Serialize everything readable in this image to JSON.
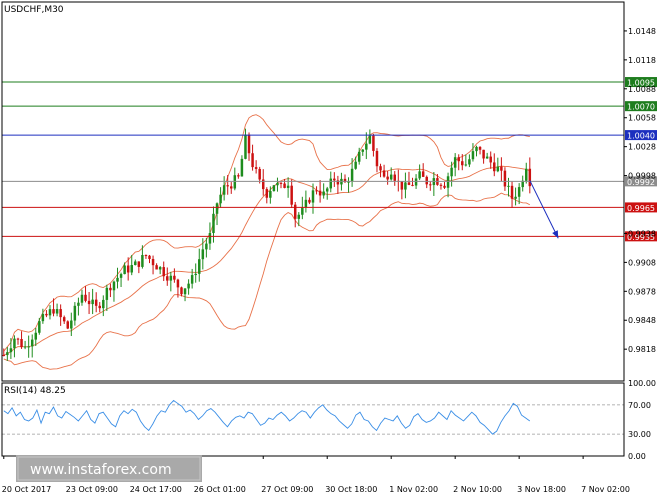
{
  "chart_data": [
    {
      "type": "candlestick",
      "title": "USDCHF,M30",
      "x_labels": [
        "20 Oct 2017",
        "23 Oct 09:00",
        "24 Oct 17:00",
        "26 Oct 01:00",
        "27 Oct 09:00",
        "30 Oct 18:00",
        "1 Nov 02:00",
        "2 Nov 10:00",
        "3 Nov 18:00",
        "7 Nov 02:00"
      ],
      "y_tick_labels": [
        "1.0148",
        "1.0118",
        "1.0088",
        "1.0058",
        "1.0028",
        "0.9998",
        "0.9938",
        "0.9908",
        "0.9878",
        "0.9848",
        "0.9818"
      ],
      "ylim": [
        0.9785,
        1.0178
      ],
      "price_path": [
        [
          0,
          0.9812
        ],
        [
          3,
          0.983
        ],
        [
          6,
          0.982
        ],
        [
          10,
          0.9845
        ],
        [
          14,
          0.986
        ],
        [
          18,
          0.984
        ],
        [
          22,
          0.9875
        ],
        [
          26,
          0.986
        ],
        [
          30,
          0.9885
        ],
        [
          34,
          0.99
        ],
        [
          37,
          0.9905
        ],
        [
          40,
          0.9915
        ],
        [
          43,
          0.9905
        ],
        [
          46,
          0.9895
        ],
        [
          50,
          0.988
        ],
        [
          53,
          0.989
        ],
        [
          56,
          0.9922
        ],
        [
          58,
          0.9935
        ],
        [
          60,
          0.997
        ],
        [
          62,
          0.9985
        ],
        [
          64,
          0.999
        ],
        [
          66,
          0.9995
        ],
        [
          68,
          1.0035
        ],
        [
          70,
          1.001
        ],
        [
          72,
          0.999
        ],
        [
          74,
          0.998
        ],
        [
          76,
          0.999
        ],
        [
          78,
          0.9985
        ],
        [
          80,
          0.9992
        ],
        [
          82,
          0.9955
        ],
        [
          84,
          0.996
        ],
        [
          86,
          0.9975
        ],
        [
          88,
          0.9985
        ],
        [
          90,
          0.9978
        ],
        [
          93,
          0.9995
        ],
        [
          96,
          0.999
        ],
        [
          99,
          1.0008
        ],
        [
          101,
          1.0028
        ],
        [
          103,
          1.0038
        ],
        [
          105,
          1.001
        ],
        [
          107,
          0.9995
        ],
        [
          109,
          1.0005
        ],
        [
          111,
          0.999
        ],
        [
          113,
          0.9985
        ],
        [
          115,
          0.999
        ],
        [
          117,
          0.9997
        ],
        [
          119,
          0.9992
        ],
        [
          121,
          0.9995
        ],
        [
          124,
          0.999
        ],
        [
          127,
          1.0015
        ],
        [
          130,
          1.001
        ],
        [
          133,
          1.0025
        ],
        [
          136,
          1.0015
        ],
        [
          139,
          1.0005
        ],
        [
          141,
          0.999
        ],
        [
          143,
          0.9975
        ],
        [
          145,
          0.9985
        ],
        [
          147,
          1.001
        ],
        [
          148,
          0.9993
        ]
      ],
      "levels": [
        {
          "value": 1.0095,
          "label": "1.0095",
          "color": "#1e7d1e"
        },
        {
          "value": 1.007,
          "label": "1.0070",
          "color": "#1e7d1e"
        },
        {
          "value": 1.004,
          "label": "1.0040",
          "color": "#1c2fbf"
        },
        {
          "value": 0.9992,
          "label": "0.9992",
          "color": "#8c8c8c"
        },
        {
          "value": 0.9965,
          "label": "0.9965",
          "color": "#cc1111"
        },
        {
          "value": 0.9935,
          "label": "0.9935",
          "color": "#cc1111"
        }
      ],
      "forecast_arrow": {
        "from": [
          0.9993,
          148
        ],
        "to": [
          0.9933,
          156
        ],
        "color": "#1c2fbf"
      },
      "colors": {
        "bull": "#1e8c1e",
        "bear": "#cc1111",
        "bands": "#e8724a"
      }
    },
    {
      "type": "line",
      "title": "RSI(14) 48.25",
      "y_tick_labels": [
        "100.00",
        "70.00",
        "30.00",
        "0.00"
      ],
      "ylim": [
        0,
        100
      ],
      "levels": [
        70,
        30
      ],
      "series": [
        {
          "values": [
            62,
            58,
            66,
            55,
            60,
            50,
            48,
            52,
            63,
            45,
            60,
            58,
            67,
            55,
            52,
            61,
            57,
            53,
            48,
            55,
            62,
            50,
            45,
            58,
            60,
            52,
            44,
            40,
            55,
            62,
            58,
            64,
            60,
            48,
            40,
            35,
            44,
            55,
            62,
            60,
            70,
            76,
            72,
            68,
            60,
            63,
            58,
            50,
            55,
            62,
            65,
            60,
            53,
            46,
            40,
            48,
            53,
            55,
            52,
            60,
            58,
            50,
            42,
            45,
            52,
            50,
            56,
            60,
            55,
            48,
            52,
            58,
            62,
            60,
            52,
            60,
            66,
            70,
            63,
            58,
            55,
            48,
            43,
            38,
            44,
            56,
            60,
            50,
            48,
            40,
            35,
            45,
            52,
            50,
            48,
            55,
            45,
            38,
            42,
            54,
            58,
            50,
            46,
            48,
            52,
            60,
            55,
            50,
            62,
            56,
            52,
            48,
            54,
            60,
            55,
            46,
            42,
            36,
            30,
            34,
            46,
            55,
            62,
            72,
            68,
            56,
            52,
            48
          ],
          "color": "#3a8ee6"
        }
      ]
    }
  ],
  "watermark": "www.instaforex.com"
}
